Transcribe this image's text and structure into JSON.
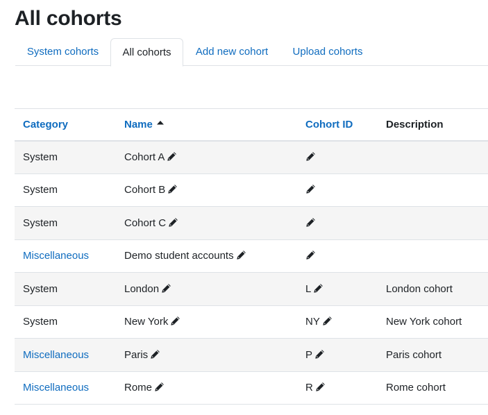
{
  "page": {
    "title": "All cohorts"
  },
  "tabs": [
    {
      "label": "System cohorts",
      "active": false
    },
    {
      "label": "All cohorts",
      "active": true
    },
    {
      "label": "Add new cohort",
      "active": false
    },
    {
      "label": "Upload cohorts",
      "active": false
    }
  ],
  "table": {
    "headers": {
      "category": "Category",
      "name": "Name",
      "cohort_id": "Cohort ID",
      "description": "Description"
    },
    "sort": {
      "column": "name",
      "direction": "ascending",
      "icon": "sort-asc-icon"
    },
    "rows": [
      {
        "category": "System",
        "category_link": false,
        "name": "Cohort A",
        "cohort_id": "",
        "description": ""
      },
      {
        "category": "System",
        "category_link": false,
        "name": "Cohort B",
        "cohort_id": "",
        "description": ""
      },
      {
        "category": "System",
        "category_link": false,
        "name": "Cohort C",
        "cohort_id": "",
        "description": ""
      },
      {
        "category": "Miscellaneous",
        "category_link": true,
        "name": "Demo student accounts",
        "cohort_id": "",
        "description": ""
      },
      {
        "category": "System",
        "category_link": false,
        "name": "London",
        "cohort_id": "L",
        "description": "London cohort"
      },
      {
        "category": "System",
        "category_link": false,
        "name": "New York",
        "cohort_id": "NY",
        "description": "New York cohort"
      },
      {
        "category": "Miscellaneous",
        "category_link": true,
        "name": "Paris",
        "cohort_id": "P",
        "description": "Paris cohort"
      },
      {
        "category": "Miscellaneous",
        "category_link": true,
        "name": "Rome",
        "cohort_id": "R",
        "description": "Rome cohort"
      }
    ]
  },
  "icons": {
    "edit": "pencil-icon"
  },
  "colors": {
    "link": "#0f6cbf",
    "text": "#1d2125",
    "stripe": "#f5f5f5",
    "border": "#dee2e6"
  }
}
